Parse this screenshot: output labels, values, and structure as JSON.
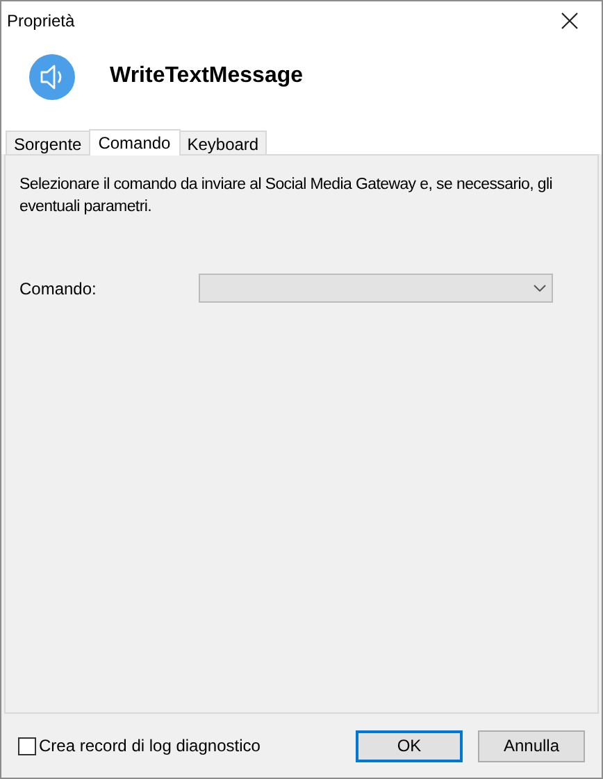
{
  "window": {
    "title": "Proprietà"
  },
  "header": {
    "title": "WriteTextMessage"
  },
  "tabs": [
    {
      "label": "Sorgente",
      "selected": false
    },
    {
      "label": "Comando",
      "selected": true
    },
    {
      "label": "Keyboard",
      "selected": false
    }
  ],
  "panel": {
    "description": "Selezionare il comando da inviare al Social Media Gateway e, se necessario, gli eventuali parametri.",
    "command_label": "Comando:",
    "command_dropdown": {
      "disabled": true
    }
  },
  "footer": {
    "checkbox": {
      "label": "Crea record di log diagnostico",
      "checked": false
    },
    "buttons": [
      {
        "label": "OK",
        "default": true
      },
      {
        "label": "Annulla",
        "default": false
      }
    ]
  }
}
